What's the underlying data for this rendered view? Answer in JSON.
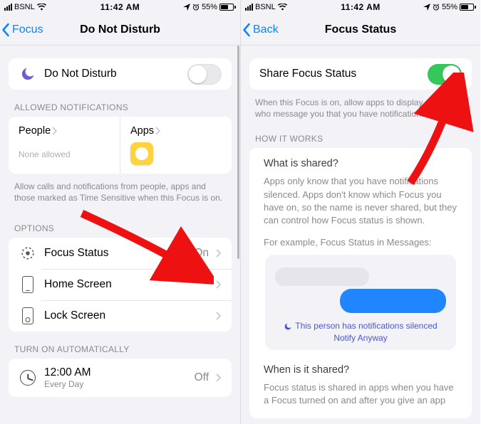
{
  "status": {
    "carrier": "BSNL",
    "time": "11:42 AM",
    "battery": "55%"
  },
  "left": {
    "nav_back": "Focus",
    "nav_title": "Do Not Disturb",
    "dnd_label": "Do Not Disturb",
    "allowed_header": "ALLOWED NOTIFICATIONS",
    "people_label": "People",
    "people_sub": "None allowed",
    "apps_label": "Apps",
    "allowed_note": "Allow calls and notifications from people, apps and those marked as Time Sensitive when this Focus is on.",
    "options_header": "OPTIONS",
    "focus_status_label": "Focus Status",
    "focus_status_value": "On",
    "home_screen_label": "Home Screen",
    "lock_screen_label": "Lock Screen",
    "auto_header": "TURN ON AUTOMATICALLY",
    "sched_time": "12:00 AM",
    "sched_sub": "Every Day",
    "sched_val": "Off"
  },
  "right": {
    "nav_back": "Back",
    "nav_title": "Focus Status",
    "share_label": "Share Focus Status",
    "share_note": "When this Focus is on, allow apps to display people who message you that you have notifications silenced.",
    "how_header": "HOW IT WORKS",
    "what_title": "What is shared?",
    "what_body": "Apps only know that you have notifications silenced. Apps don't know which Focus you have on, so the name is never shared, but they can control how Focus status is shown.",
    "what_eg": "For example, Focus Status in Messages:",
    "chat_l1": "This person has notifications silenced",
    "chat_l2": "Notify Anyway",
    "when_title": "When is it shared?",
    "when_body": "Focus status is shared in apps when you have a Focus turned on and after you give an app"
  }
}
